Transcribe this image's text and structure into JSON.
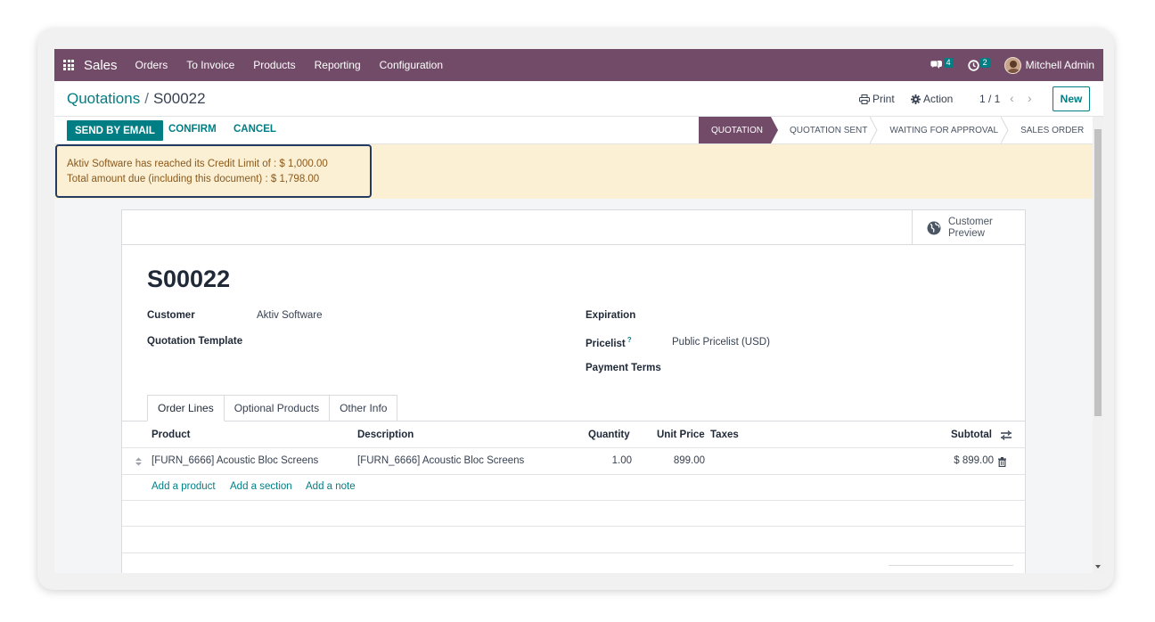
{
  "navbar": {
    "brand": "Sales",
    "items": [
      "Orders",
      "To Invoice",
      "Products",
      "Reporting",
      "Configuration"
    ],
    "messages_count": "4",
    "activities_count": "2",
    "user": "Mitchell Admin",
    "icons": [
      "apps-grid-icon",
      "chat-icon",
      "clock-icon"
    ]
  },
  "control_panel": {
    "breadcrumb_parent": "Quotations",
    "breadcrumb_separator": "/",
    "breadcrumb_current": "S00022",
    "print_label": "Print",
    "action_label": "Action",
    "pager": "1 / 1",
    "new_label": "New"
  },
  "statusbar": {
    "buttons": [
      "SEND BY EMAIL",
      "CONFIRM",
      "CANCEL"
    ],
    "stages": [
      "QUOTATION",
      "QUOTATION SENT",
      "WAITING FOR APPROVAL",
      "SALES ORDER"
    ],
    "active_stage": "QUOTATION"
  },
  "alert": {
    "line1": "Aktiv Software has reached its Credit Limit of : $ 1,000.00",
    "line2": "Total amount due (including this document) : $ 1,798.00"
  },
  "sheet": {
    "customer_preview_label": "Customer Preview",
    "title": "S00022",
    "fields": {
      "customer_label": "Customer",
      "customer_value": "Aktiv Software",
      "template_label": "Quotation Template",
      "expiration_label": "Expiration",
      "pricelist_label": "Pricelist",
      "pricelist_help": "?",
      "pricelist_value": "Public Pricelist (USD)",
      "payment_terms_label": "Payment Terms"
    },
    "tabs": [
      "Order Lines",
      "Optional Products",
      "Other Info"
    ],
    "columns": [
      "Product",
      "Description",
      "Quantity",
      "Unit Price",
      "Taxes",
      "Subtotal"
    ],
    "lines": [
      {
        "product": "[FURN_6666] Acoustic Bloc Screens",
        "description": "[FURN_6666] Acoustic Bloc Screens",
        "quantity": "1.00",
        "unit_price": "899.00",
        "taxes": "",
        "subtotal": "$ 899.00"
      }
    ],
    "add_links": [
      "Add a product",
      "Add a section",
      "Add a note"
    ]
  },
  "colors": {
    "brand": "#714b67",
    "accent": "#017e84",
    "alert_bg": "#fbefd4",
    "alert_text": "#8a5a1c",
    "highlight_border": "#243b63"
  }
}
